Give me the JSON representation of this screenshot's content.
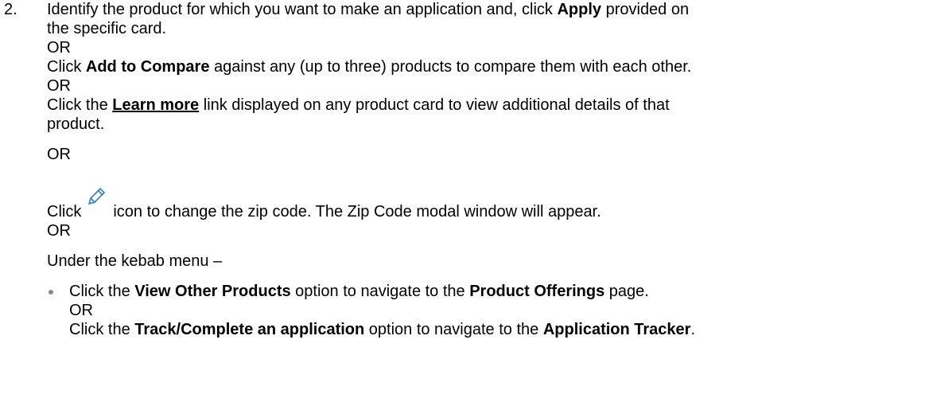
{
  "step_number": "2.",
  "para1": {
    "line1_pre": "Identify the product for which you want to make an application and, click ",
    "line1_bold": "Apply",
    "line1_post": " provided on",
    "line2": "the specific card."
  },
  "or_label": "OR",
  "para2": {
    "pre": "Click ",
    "bold": "Add to Compare",
    "post": " against any (up to three) products to compare them with each other."
  },
  "para3": {
    "pre": "Click the ",
    "link": "Learn more",
    "post": " link displayed on any product card to view additional details of that",
    "line2": "product."
  },
  "para4": {
    "pre": "Click",
    "post": "icon to change the zip code. The Zip Code modal window will appear.",
    "icon": "pencil-edit-icon",
    "icon_color": "#2e7fd6"
  },
  "para5": {
    "text": "Under the kebab menu –"
  },
  "bullet1": {
    "pre": "Click the ",
    "bold1": "View Other Products",
    "mid": " option to navigate to the ",
    "bold2": "Product Offerings",
    "post": " page."
  },
  "bullet1b": {
    "pre": "Click the ",
    "bold1": "Track/Complete an application",
    "mid": " option to navigate to the ",
    "bold2": "Application Tracker",
    "post": "."
  }
}
